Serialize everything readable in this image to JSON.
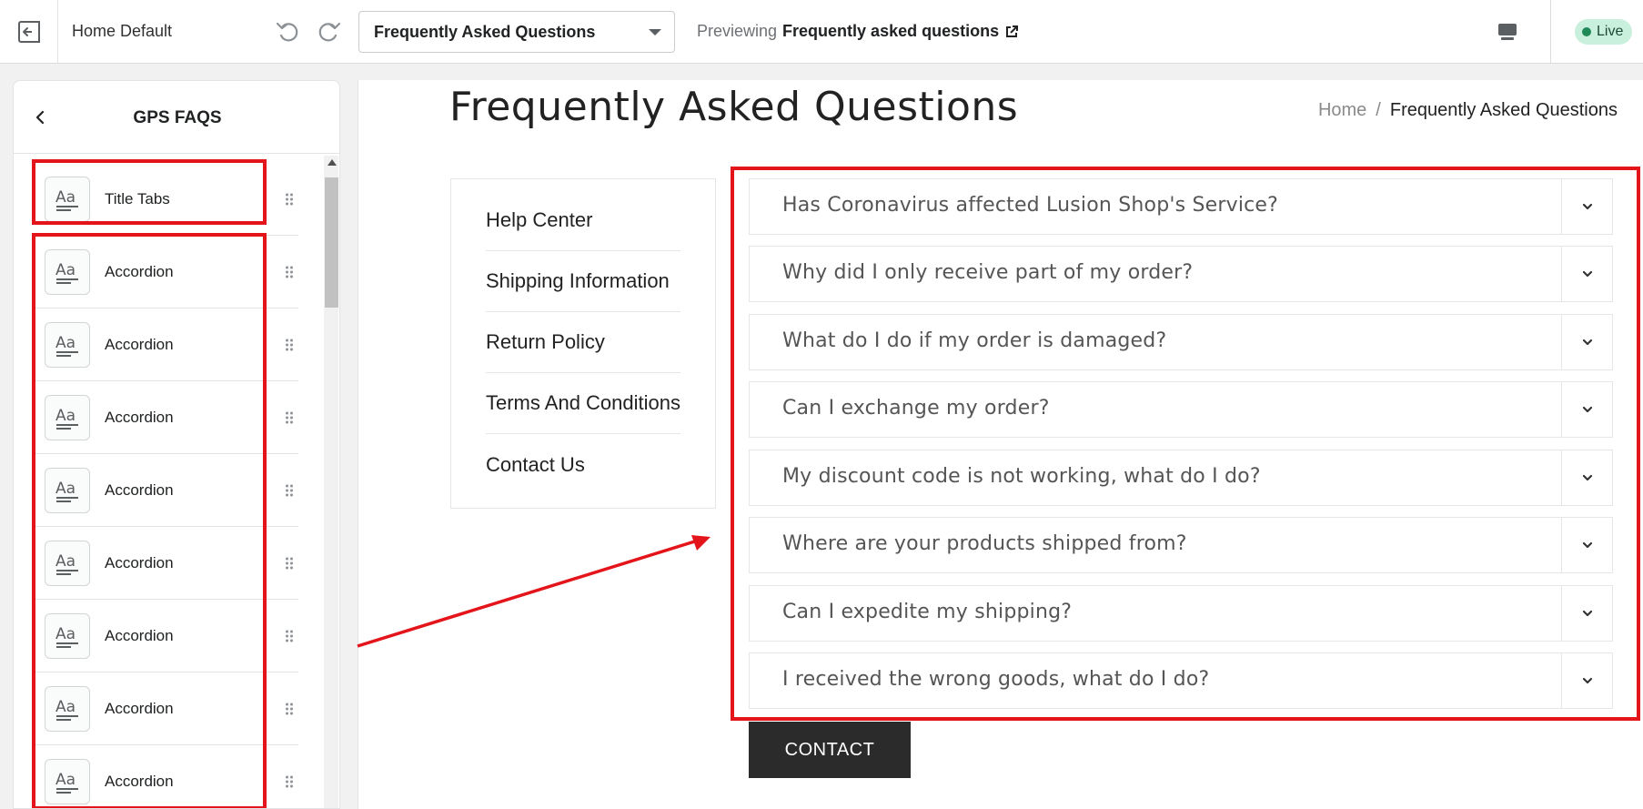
{
  "topbar": {
    "theme_name": "Home Default",
    "page_select_value": "Frequently Asked Questions",
    "previewing_label": "Previewing",
    "previewing_target": "Frequently asked questions",
    "live_label": "Live"
  },
  "panel": {
    "title": "GPS FAQS",
    "blocks": [
      {
        "label": "Title Tabs"
      },
      {
        "label": "Accordion"
      },
      {
        "label": "Accordion"
      },
      {
        "label": "Accordion"
      },
      {
        "label": "Accordion"
      },
      {
        "label": "Accordion"
      },
      {
        "label": "Accordion"
      },
      {
        "label": "Accordion"
      },
      {
        "label": "Accordion"
      }
    ]
  },
  "preview": {
    "title": "Frequently Asked Questions",
    "breadcrumb": {
      "home": "Home",
      "separator": "/",
      "current": "Frequently Asked Questions"
    },
    "nav": [
      {
        "label": "Help Center"
      },
      {
        "label": "Shipping Information"
      },
      {
        "label": "Return Policy"
      },
      {
        "label": "Terms And Conditions"
      },
      {
        "label": "Contact Us"
      }
    ],
    "accordions": [
      {
        "question": "Has Coronavirus affected Lusion Shop's Service?"
      },
      {
        "question": "Why did I only receive part of my order?"
      },
      {
        "question": "What do I do if my order is damaged?"
      },
      {
        "question": "Can I exchange my order?"
      },
      {
        "question": "My discount code is not working, what do I do?"
      },
      {
        "question": "Where are your products shipped from?"
      },
      {
        "question": "Can I expedite my shipping?"
      },
      {
        "question": "I received the wrong goods, what do I do?"
      }
    ],
    "contact_button": "CONTACT"
  },
  "colors": {
    "annotation": "#e3151a",
    "live_badge": "#c9f0dc",
    "live_dot": "#1f8a57",
    "contact_bg": "#2b2b2b"
  },
  "icons": [
    "exit-icon",
    "undo-icon",
    "redo-icon",
    "external-link-icon",
    "desktop-icon",
    "chevron-left-icon",
    "text-block-icon",
    "drag-handle-icon",
    "chevron-down-icon"
  ]
}
